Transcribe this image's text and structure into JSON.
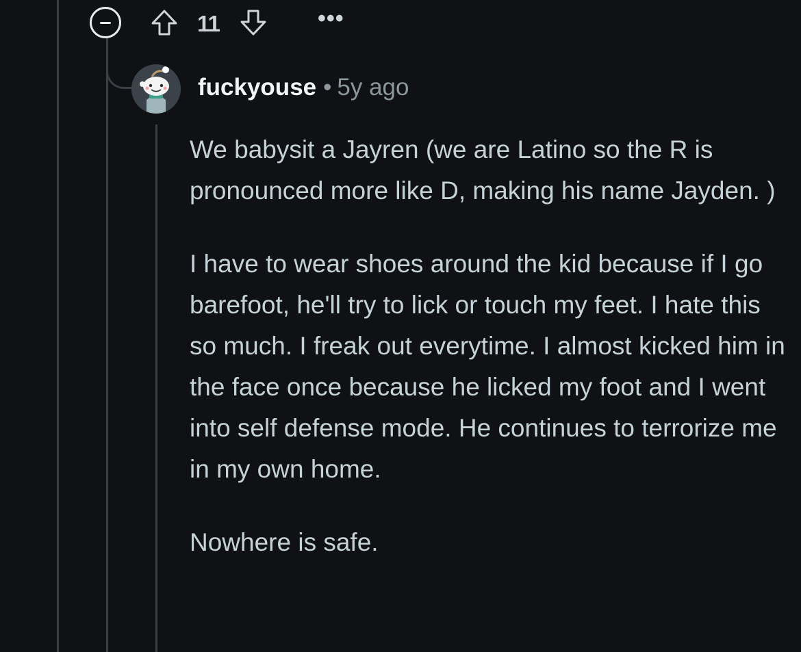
{
  "actions": {
    "score": "11",
    "more_label": "•••"
  },
  "comment": {
    "author": "fuckyouse",
    "separator": "•",
    "timestamp": "5y ago",
    "paragraphs": [
      "We babysit a Jayren (we are Latino so the R is pronounced more like D, making his name Jayden. )",
      "I have to wear shoes around the kid because if I go barefoot, he'll try to lick or touch my feet. I hate this so much. I freak out everytime. I almost kicked him in the face once because he licked my foot and I went into self defense mode. He continues to terrorize me in my own home.",
      "Nowhere is safe."
    ]
  },
  "icons": {
    "collapse": "collapse-minus-icon",
    "upvote": "upvote-arrow-icon",
    "downvote": "downvote-arrow-icon",
    "more": "more-dots-icon"
  },
  "colors": {
    "background": "#0f1114",
    "thread_line": "#3a3f45",
    "body_text": "#c5d3d8",
    "meta_text": "#8c979d"
  }
}
